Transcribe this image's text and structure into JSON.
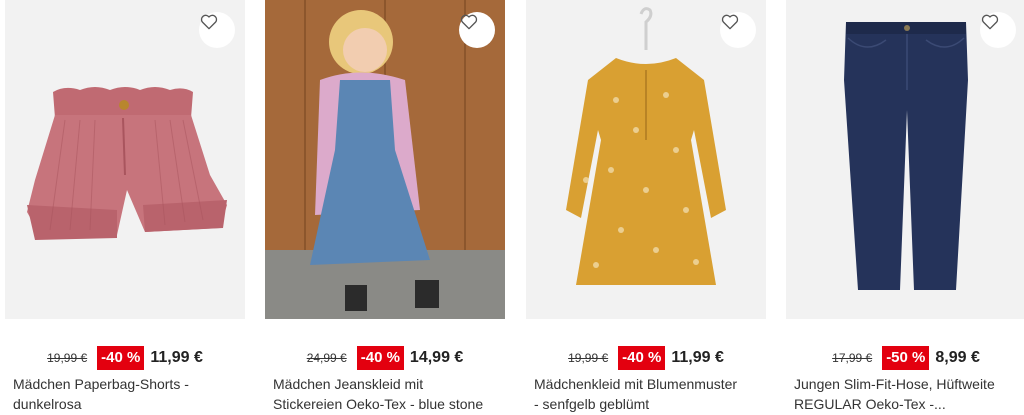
{
  "products": [
    {
      "old_price": "19,99 €",
      "discount": "-40 %",
      "new_price": "11,99 €",
      "title_line1": "Mädchen Paperbag-Shorts -",
      "title_line2": "dunkelrosa",
      "image": "pink-corduroy-shorts"
    },
    {
      "old_price": "24,99 €",
      "discount": "-40 %",
      "new_price": "14,99 €",
      "title_line1": "Mädchen Jeanskleid mit",
      "title_line2": "Stickereien Oeko-Tex - blue stone",
      "image": "girl-denim-dress-pink-cardigan"
    },
    {
      "old_price": "19,99 €",
      "discount": "-40 %",
      "new_price": "11,99 €",
      "title_line1": "Mädchenkleid mit Blumenmuster",
      "title_line2": "- senfgelb geblümt",
      "image": "mustard-floral-dress"
    },
    {
      "old_price": "17,99 €",
      "discount": "-50 %",
      "new_price": "8,99 €",
      "title_line1": "Jungen Slim-Fit-Hose, Hüftweite",
      "title_line2": "REGULAR Oeko-Tex -...",
      "image": "navy-slim-trousers"
    }
  ],
  "icons": {
    "favorite": "heart-outline-icon"
  },
  "colors": {
    "discount_bg": "#e3000f",
    "image_bg": "#f2f2f2"
  }
}
